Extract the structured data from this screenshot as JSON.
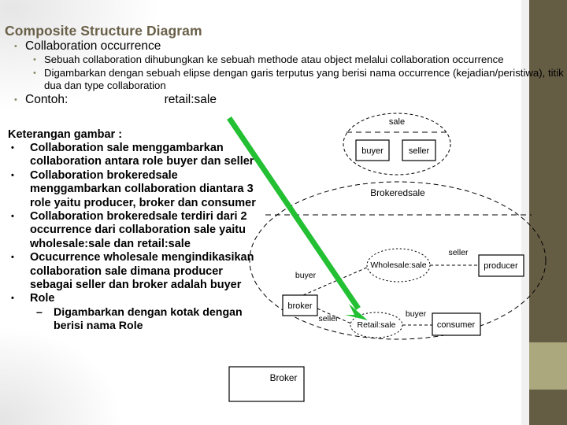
{
  "slide": {
    "title": "Composite Structure Diagram",
    "accent_dark": "#655c44",
    "accent_light": "#aaa87c",
    "title_color": "#6a6049",
    "arrow_color": "#22c032"
  },
  "top_bullets": {
    "heading": "Collaboration occurrence",
    "sub": [
      "Sebuah collaboration dihubungkan ke sebuah methode atau object melalui collaboration occurrence",
      "Digambarkan dengan sebuah elipse dengan garis terputus yang berisi nama occurrence (kejadian/peristiwa), titik dua dan type collaboration"
    ],
    "contoh_label": "Contoh:",
    "contoh_value": "retail:sale"
  },
  "left_column": {
    "heading": "Keterangan gambar :",
    "items": [
      "Collaboration sale menggambarkan collaboration antara role buyer dan seller",
      "Collaboration brokeredsale menggambarkan collaboration diantara 3 role yaitu producer, broker dan consumer",
      "Collaboration brokeredsale terdiri dari 2 occurrence dari collaboration sale yaitu wholesale:sale dan retail:sale",
      "Ocucurrence wholesale mengindikasikan collaboration sale dimana producer sebagai seller dan broker adalah buyer",
      "Role"
    ],
    "sub_item": "Digambarkan dengan kotak dengan berisi nama Role",
    "bullet_glyph": "•",
    "dash_glyph": "–"
  },
  "diagram": {
    "sale_collab": {
      "name": "sale",
      "roles": [
        "buyer",
        "seller"
      ]
    },
    "brokered_collab": {
      "name": "Brokeredsale",
      "occurrences": [
        "Wholesale:sale",
        "Retail:sale"
      ],
      "boxes": [
        "producer",
        "broker",
        "consumer"
      ],
      "edge_labels": [
        "seller",
        "buyer",
        "seller",
        "buyer"
      ]
    },
    "role_box": "Broker"
  }
}
